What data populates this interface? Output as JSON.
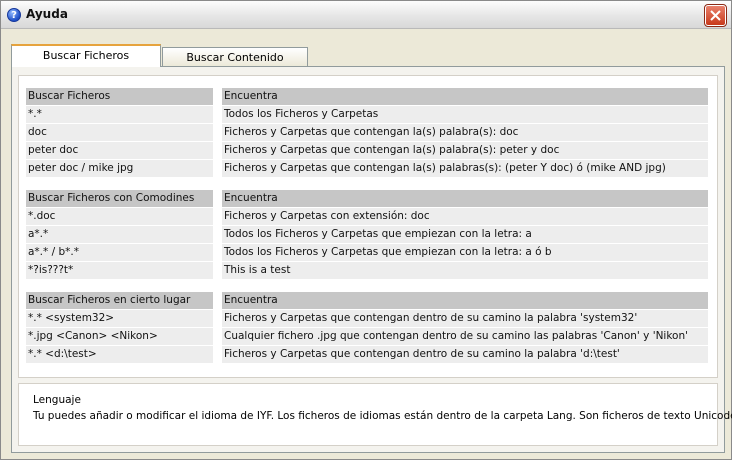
{
  "window": {
    "title": "Ayuda",
    "icon": "help-icon",
    "accent": "#e6a33d"
  },
  "tabs": [
    {
      "label": "Buscar Ficheros",
      "active": true
    },
    {
      "label": "Buscar Contenido",
      "active": false
    }
  ],
  "groups": [
    {
      "header": [
        "Buscar Ficheros",
        "Encuentra"
      ],
      "rows": [
        [
          "*.*",
          "Todos los Ficheros y Carpetas"
        ],
        [
          "doc",
          "Ficheros y Carpetas que contengan la(s) palabra(s): doc"
        ],
        [
          "peter doc",
          "Ficheros y Carpetas que contengan la(s) palabra(s): peter y doc"
        ],
        [
          "peter doc / mike jpg",
          "Ficheros y Carpetas que contengan la(s) palabras(s): (peter Y doc) ó (mike AND jpg)"
        ]
      ]
    },
    {
      "header": [
        "Buscar Ficheros con Comodines",
        "Encuentra"
      ],
      "rows": [
        [
          "*.doc",
          "Ficheros y Carpetas con extensión: doc"
        ],
        [
          "a*.*",
          "Todos los Ficheros y Carpetas que empiezan con la letra: a"
        ],
        [
          "a*.* / b*.*",
          "Todos los Ficheros y Carpetas que empiezan con la letra: a ó b"
        ],
        [
          "*?is???t*",
          "This is a test"
        ]
      ]
    },
    {
      "header": [
        "Buscar Ficheros en cierto lugar",
        "Encuentra"
      ],
      "rows": [
        [
          "*.* <system32>",
          "Ficheros y Carpetas que contengan dentro de su camino la palabra 'system32'"
        ],
        [
          "*.jpg <Canon> <Nikon>",
          "Cualquier fichero .jpg que contengan dentro de su camino las palabras 'Canon' y 'Nikon'"
        ],
        [
          "*.* <d:\\test>",
          "Ficheros y Carpetas que contengan dentro de su camino la palabra 'd:\\test'"
        ]
      ]
    }
  ],
  "language": {
    "title": "Lenguaje",
    "text": "Tu puedes añadir o modificar el idioma de IYF. Los ficheros de idiomas están dentro de la carpeta Lang. Son ficheros de texto Unicode"
  }
}
